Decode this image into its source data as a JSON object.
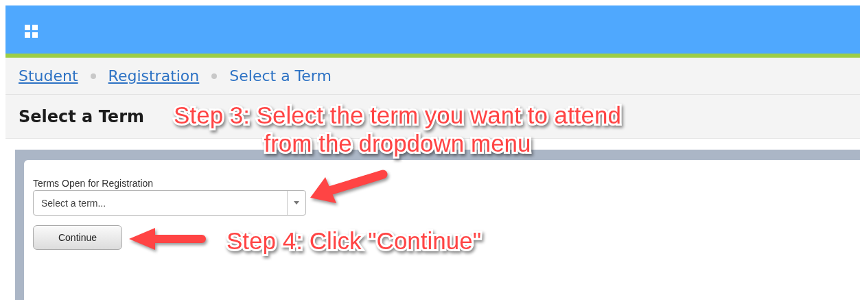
{
  "breadcrumb": [
    {
      "label": "Student",
      "kind": "link"
    },
    {
      "label": "Registration",
      "kind": "link"
    },
    {
      "label": "Select a Term",
      "kind": "current"
    }
  ],
  "page_title": "Select a Term",
  "form": {
    "label": "Terms Open for Registration",
    "select": {
      "placeholder": "Select a term..."
    },
    "button": "Continue"
  },
  "annotations": [
    {
      "kind": "step",
      "text": "Step 3: Select the term you want to attend\nfrom the dropdown menu"
    },
    {
      "kind": "step",
      "text": "Step 4: Click \"Continue\""
    }
  ]
}
